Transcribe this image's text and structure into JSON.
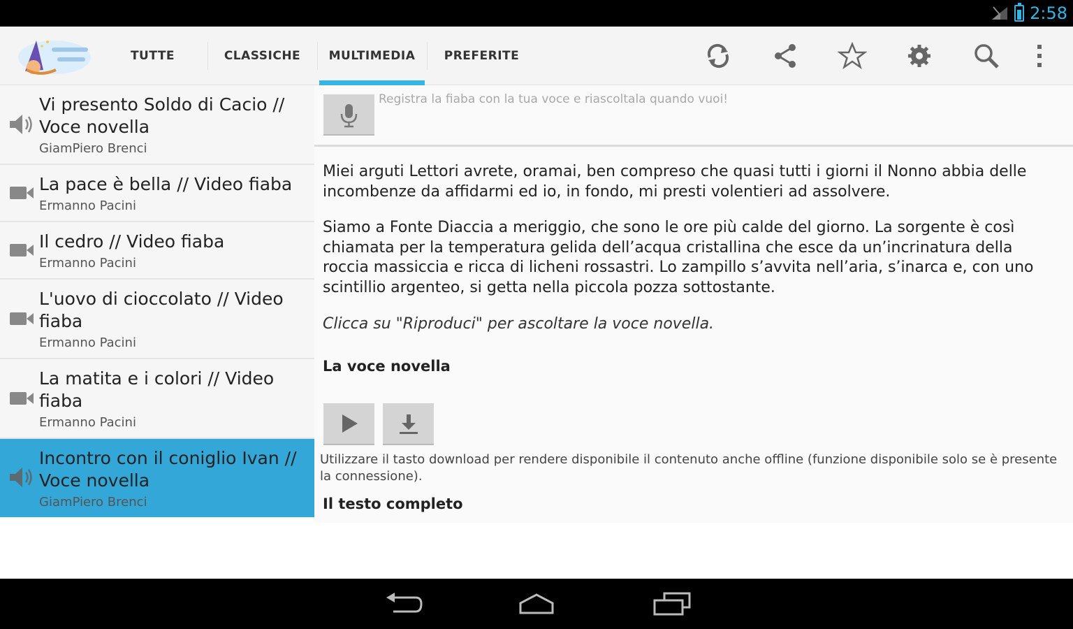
{
  "status": {
    "time": "2:58"
  },
  "app": {
    "logo_icon": "app-logo-fairy-tale",
    "tabs": [
      {
        "label": "TUTTE",
        "active": false
      },
      {
        "label": "CLASSICHE",
        "active": false
      },
      {
        "label": "MULTIMEDIA",
        "active": true
      },
      {
        "label": "PREFERITE",
        "active": false
      }
    ],
    "actions": [
      "refresh-icon",
      "share-icon",
      "star-icon",
      "settings-icon",
      "search-icon",
      "overflow-menu-icon"
    ]
  },
  "list": {
    "items": [
      {
        "title": "Vi presento Soldo di Cacio // Voce novella",
        "author": "GiamPiero Brenci",
        "icon": "audio-icon",
        "selected": false
      },
      {
        "title": "La pace è bella // Video fiaba",
        "author": "Ermanno Pacini",
        "icon": "video-icon",
        "selected": false
      },
      {
        "title": "Il cedro // Video fiaba",
        "author": "Ermanno Pacini",
        "icon": "video-icon",
        "selected": false
      },
      {
        "title": "L'uovo di cioccolato // Video fiaba",
        "author": "Ermanno Pacini",
        "icon": "video-icon",
        "selected": false
      },
      {
        "title": "La matita e i colori // Video fiaba",
        "author": "Ermanno Pacini",
        "icon": "video-icon",
        "selected": false
      },
      {
        "title": "Incontro con il coniglio Ivan // Voce novella",
        "author": "GiamPiero Brenci",
        "icon": "audio-icon",
        "selected": true
      }
    ]
  },
  "detail": {
    "record_hint": "Registra la fiaba con la tua voce e riascoltala quando vuoi!",
    "paragraph1": "Miei arguti Lettori avrete, oramai, ben compreso che quasi tutti i giorni il Nonno abbia delle incombenze da affidarmi ed io, in fondo, mi presti volentieri ad assolvere.",
    "paragraph2": "Siamo a Fonte Diaccia  a meriggio, che sono le ore più calde del giorno. La sorgente è così chiamata per la temperatura gelida dell’acqua cristallina che esce da un’incrinatura della roccia massiccia e ricca di licheni rossastri. Lo zampillo s’avvita nell’aria, s’inarca e, con uno scintillio argenteo, si getta nella piccola pozza sottostante.",
    "instruction": "Clicca su \"Riproduci\" per ascoltare la voce novella.",
    "voice_heading": "La voce novella",
    "download_note": "Utilizzare il tasto download per rendere disponibile il contenuto anche offline (funzione disponibile solo se è presente la connessione).",
    "full_text_heading": "Il testo completo"
  },
  "navbar": [
    "back-icon",
    "home-icon",
    "recent-apps-icon"
  ],
  "colors": {
    "accent": "#33b5e5",
    "selected": "#33a7d7"
  }
}
